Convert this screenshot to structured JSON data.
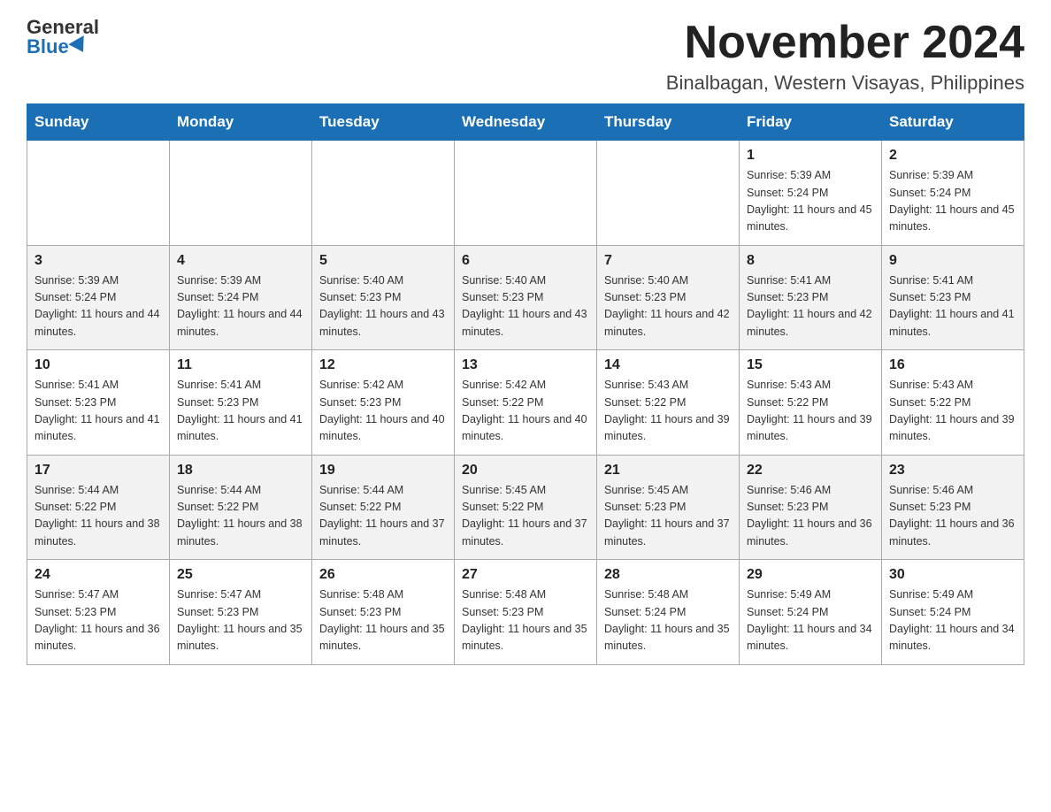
{
  "header": {
    "logo_general": "General",
    "logo_blue": "Blue",
    "month_title": "November 2024",
    "location": "Binalbagan, Western Visayas, Philippines"
  },
  "weekdays": [
    "Sunday",
    "Monday",
    "Tuesday",
    "Wednesday",
    "Thursday",
    "Friday",
    "Saturday"
  ],
  "weeks": [
    [
      {
        "day": "",
        "info": ""
      },
      {
        "day": "",
        "info": ""
      },
      {
        "day": "",
        "info": ""
      },
      {
        "day": "",
        "info": ""
      },
      {
        "day": "",
        "info": ""
      },
      {
        "day": "1",
        "info": "Sunrise: 5:39 AM\nSunset: 5:24 PM\nDaylight: 11 hours and 45 minutes."
      },
      {
        "day": "2",
        "info": "Sunrise: 5:39 AM\nSunset: 5:24 PM\nDaylight: 11 hours and 45 minutes."
      }
    ],
    [
      {
        "day": "3",
        "info": "Sunrise: 5:39 AM\nSunset: 5:24 PM\nDaylight: 11 hours and 44 minutes."
      },
      {
        "day": "4",
        "info": "Sunrise: 5:39 AM\nSunset: 5:24 PM\nDaylight: 11 hours and 44 minutes."
      },
      {
        "day": "5",
        "info": "Sunrise: 5:40 AM\nSunset: 5:23 PM\nDaylight: 11 hours and 43 minutes."
      },
      {
        "day": "6",
        "info": "Sunrise: 5:40 AM\nSunset: 5:23 PM\nDaylight: 11 hours and 43 minutes."
      },
      {
        "day": "7",
        "info": "Sunrise: 5:40 AM\nSunset: 5:23 PM\nDaylight: 11 hours and 42 minutes."
      },
      {
        "day": "8",
        "info": "Sunrise: 5:41 AM\nSunset: 5:23 PM\nDaylight: 11 hours and 42 minutes."
      },
      {
        "day": "9",
        "info": "Sunrise: 5:41 AM\nSunset: 5:23 PM\nDaylight: 11 hours and 41 minutes."
      }
    ],
    [
      {
        "day": "10",
        "info": "Sunrise: 5:41 AM\nSunset: 5:23 PM\nDaylight: 11 hours and 41 minutes."
      },
      {
        "day": "11",
        "info": "Sunrise: 5:41 AM\nSunset: 5:23 PM\nDaylight: 11 hours and 41 minutes."
      },
      {
        "day": "12",
        "info": "Sunrise: 5:42 AM\nSunset: 5:23 PM\nDaylight: 11 hours and 40 minutes."
      },
      {
        "day": "13",
        "info": "Sunrise: 5:42 AM\nSunset: 5:22 PM\nDaylight: 11 hours and 40 minutes."
      },
      {
        "day": "14",
        "info": "Sunrise: 5:43 AM\nSunset: 5:22 PM\nDaylight: 11 hours and 39 minutes."
      },
      {
        "day": "15",
        "info": "Sunrise: 5:43 AM\nSunset: 5:22 PM\nDaylight: 11 hours and 39 minutes."
      },
      {
        "day": "16",
        "info": "Sunrise: 5:43 AM\nSunset: 5:22 PM\nDaylight: 11 hours and 39 minutes."
      }
    ],
    [
      {
        "day": "17",
        "info": "Sunrise: 5:44 AM\nSunset: 5:22 PM\nDaylight: 11 hours and 38 minutes."
      },
      {
        "day": "18",
        "info": "Sunrise: 5:44 AM\nSunset: 5:22 PM\nDaylight: 11 hours and 38 minutes."
      },
      {
        "day": "19",
        "info": "Sunrise: 5:44 AM\nSunset: 5:22 PM\nDaylight: 11 hours and 37 minutes."
      },
      {
        "day": "20",
        "info": "Sunrise: 5:45 AM\nSunset: 5:22 PM\nDaylight: 11 hours and 37 minutes."
      },
      {
        "day": "21",
        "info": "Sunrise: 5:45 AM\nSunset: 5:23 PM\nDaylight: 11 hours and 37 minutes."
      },
      {
        "day": "22",
        "info": "Sunrise: 5:46 AM\nSunset: 5:23 PM\nDaylight: 11 hours and 36 minutes."
      },
      {
        "day": "23",
        "info": "Sunrise: 5:46 AM\nSunset: 5:23 PM\nDaylight: 11 hours and 36 minutes."
      }
    ],
    [
      {
        "day": "24",
        "info": "Sunrise: 5:47 AM\nSunset: 5:23 PM\nDaylight: 11 hours and 36 minutes."
      },
      {
        "day": "25",
        "info": "Sunrise: 5:47 AM\nSunset: 5:23 PM\nDaylight: 11 hours and 35 minutes."
      },
      {
        "day": "26",
        "info": "Sunrise: 5:48 AM\nSunset: 5:23 PM\nDaylight: 11 hours and 35 minutes."
      },
      {
        "day": "27",
        "info": "Sunrise: 5:48 AM\nSunset: 5:23 PM\nDaylight: 11 hours and 35 minutes."
      },
      {
        "day": "28",
        "info": "Sunrise: 5:48 AM\nSunset: 5:24 PM\nDaylight: 11 hours and 35 minutes."
      },
      {
        "day": "29",
        "info": "Sunrise: 5:49 AM\nSunset: 5:24 PM\nDaylight: 11 hours and 34 minutes."
      },
      {
        "day": "30",
        "info": "Sunrise: 5:49 AM\nSunset: 5:24 PM\nDaylight: 11 hours and 34 minutes."
      }
    ]
  ]
}
